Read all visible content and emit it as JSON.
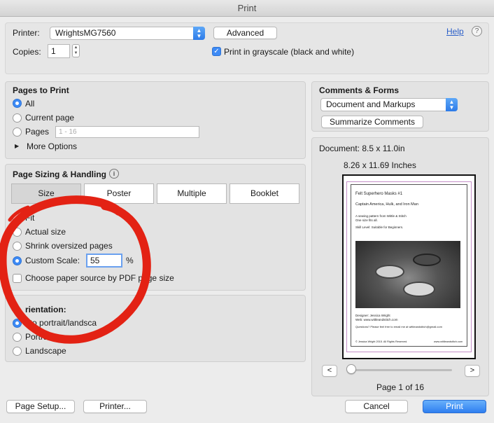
{
  "window": {
    "title": "Print"
  },
  "printer": {
    "label": "Printer:",
    "value": "WrightsMG7560",
    "advanced_label": "Advanced",
    "help_label": "Help",
    "copies_label": "Copies:",
    "copies_value": "1",
    "grayscale_label": "Print in grayscale (black and white)",
    "grayscale_checked": true
  },
  "pages_to_print": {
    "header": "Pages to Print",
    "options": [
      "All",
      "Current page",
      "Pages"
    ],
    "selected": "All",
    "pages_placeholder": "1 - 16",
    "more_options": "More Options"
  },
  "sizing": {
    "header": "Page Sizing & Handling",
    "tabs": [
      "Size",
      "Poster",
      "Multiple",
      "Booklet"
    ],
    "active_tab": "Size",
    "options": [
      "Fit",
      "Actual size",
      "Shrink oversized pages",
      "Custom Scale:"
    ],
    "selected": "Custom Scale:",
    "scale_value": "55",
    "scale_unit": "%",
    "paper_source_label": "Choose paper source by PDF page size"
  },
  "orientation": {
    "header": "rientation:",
    "options": [
      "uto portrait/landsca",
      "Portra",
      "Landscape"
    ],
    "selected": "uto portrait/landsca"
  },
  "comments": {
    "header": "Comments & Forms",
    "value": "Document and Markups",
    "summarize_label": "Summarize Comments"
  },
  "preview": {
    "document_size": "Document: 8.5 x 11.0in",
    "page_size": "8.26 x 11.69 Inches",
    "page_label": "Page 1 of 16",
    "slider_fraction": 0.0,
    "prev_label": "<",
    "next_label": ">",
    "content": {
      "title": "Felt Superhero Masks #1",
      "subtitle": "Captain America, Hulk, and Iron Man",
      "intro1": "A sewing pattern from Wittle & Stitch",
      "intro2": "One size fits all.",
      "skill": "Skill Level: Suitable for Beginners.",
      "designer": "Designer: Jessica Wright",
      "web": "Web: www.wittleandstitch.com",
      "questions": "Questions? Please feel free to email me at wittleandstitch@gmail.com",
      "footer_left": "© Jessica Wright 2015. All Rights Reserved.",
      "footer_right": "www.wittleandstitch.com"
    }
  },
  "footer": {
    "page_setup_label": "Page Setup...",
    "printer_label": "Printer...",
    "cancel_label": "Cancel",
    "print_label": "Print"
  },
  "colors": {
    "accent": "#3d8af5",
    "annotation": "#e32214"
  }
}
